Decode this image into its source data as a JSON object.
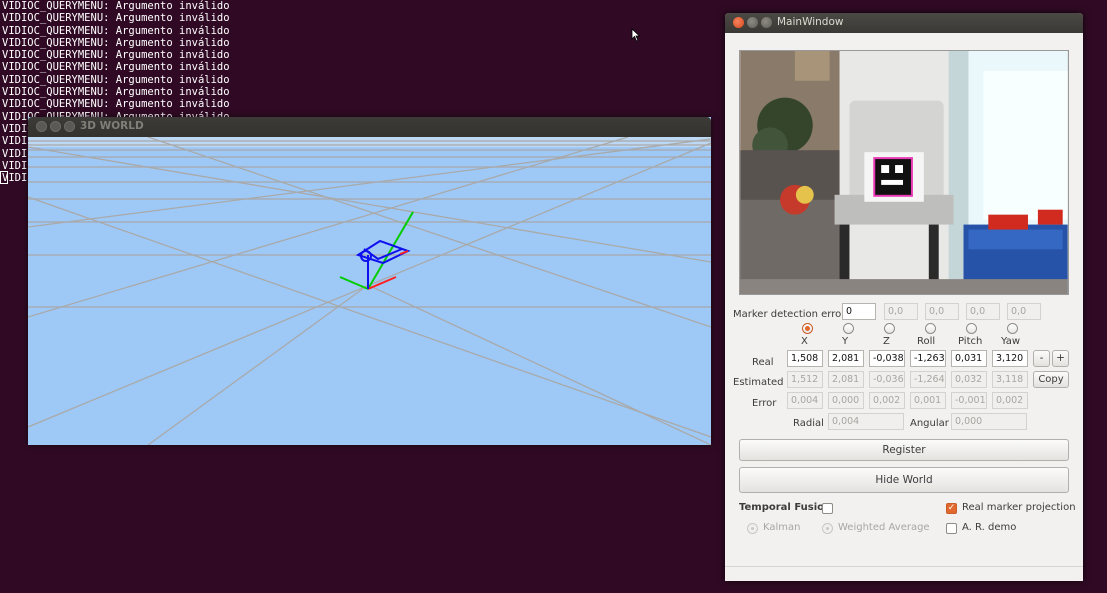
{
  "terminal": {
    "lines": [
      "VIDIOC_QUERYMENU: Argumento inválido",
      "VIDIOC_QUERYMENU: Argumento inválido",
      "VIDIOC_QUERYMENU: Argumento inválido",
      "VIDIOC_QUERYMENU: Argumento inválido",
      "VIDIOC_QUERYMENU: Argumento inválido",
      "VIDIOC_QUERYMENU: Argumento inválido",
      "VIDIOC_QUERYMENU: Argumento inválido",
      "VIDIOC_QUERYMENU: Argumento inválido",
      "VIDIOC_QUERYMENU: Argumento inválido",
      "VIDIOC_QUERYMENU: Argumento inválido",
      "VIDIOC_QUERYMENU: Argumento inválido",
      "VIDI",
      "VIDI",
      "VIDI",
      "VIDI"
    ]
  },
  "world_window": {
    "title": "3D WORLD"
  },
  "main_window": {
    "title": "MainWindow",
    "marker_detection_error": {
      "label": "Marker detection error",
      "value": "0",
      "disabled_values": [
        "0,0",
        "0,0",
        "0,0",
        "0,0"
      ]
    },
    "columns": [
      "X",
      "Y",
      "Z",
      "Roll",
      "Pitch",
      "Yaw"
    ],
    "selected_column": "X",
    "rows": {
      "real": {
        "label": "Real",
        "values": [
          "1,508",
          "2,081",
          "-0,038",
          "-1,263",
          "0,031",
          "3,120"
        ]
      },
      "estimated": {
        "label": "Estimated",
        "values": [
          "1,512",
          "2,081",
          "-0,036",
          "-1,264",
          "0,032",
          "3,118"
        ]
      },
      "error": {
        "label": "Error",
        "values": [
          "0,004",
          "0,000",
          "0,002",
          "0,001",
          "-0,001",
          "0,002"
        ]
      }
    },
    "radial": {
      "label": "Radial",
      "value": "0,004"
    },
    "angular": {
      "label": "Angular",
      "value": "0,000"
    },
    "minus_label": "-",
    "plus_label": "+",
    "copy_label": "Copy",
    "register_label": "Register",
    "hide_world_label": "Hide World",
    "temporal_fusion": {
      "label": "Temporal Fusion",
      "checked": false
    },
    "real_marker_projection": {
      "label": "Real marker projection",
      "checked": true
    },
    "kalman_label": "Kalman",
    "weighted_average_label": "Weighted Average",
    "ar_demo": {
      "label": "A. R. demo",
      "checked": false
    },
    "colors": {
      "accent": "#e2682d",
      "titlebar": "#3c3b37"
    }
  }
}
